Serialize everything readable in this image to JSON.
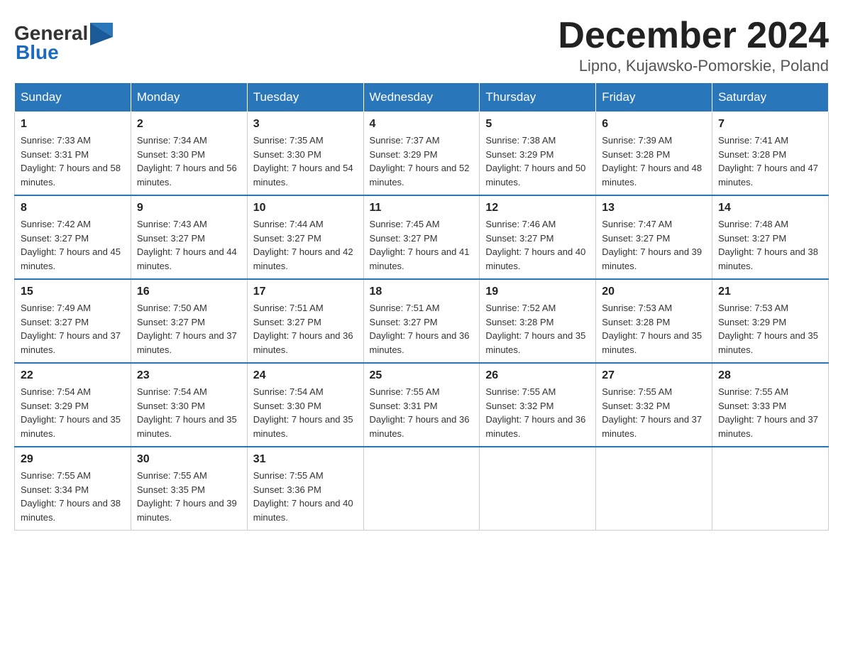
{
  "header": {
    "logo_general": "General",
    "logo_blue": "Blue",
    "month_title": "December 2024",
    "subtitle": "Lipno, Kujawsko-Pomorskie, Poland"
  },
  "days_of_week": [
    "Sunday",
    "Monday",
    "Tuesday",
    "Wednesday",
    "Thursday",
    "Friday",
    "Saturday"
  ],
  "weeks": [
    [
      {
        "day": "1",
        "sunrise": "7:33 AM",
        "sunset": "3:31 PM",
        "daylight": "7 hours and 58 minutes."
      },
      {
        "day": "2",
        "sunrise": "7:34 AM",
        "sunset": "3:30 PM",
        "daylight": "7 hours and 56 minutes."
      },
      {
        "day": "3",
        "sunrise": "7:35 AM",
        "sunset": "3:30 PM",
        "daylight": "7 hours and 54 minutes."
      },
      {
        "day": "4",
        "sunrise": "7:37 AM",
        "sunset": "3:29 PM",
        "daylight": "7 hours and 52 minutes."
      },
      {
        "day": "5",
        "sunrise": "7:38 AM",
        "sunset": "3:29 PM",
        "daylight": "7 hours and 50 minutes."
      },
      {
        "day": "6",
        "sunrise": "7:39 AM",
        "sunset": "3:28 PM",
        "daylight": "7 hours and 48 minutes."
      },
      {
        "day": "7",
        "sunrise": "7:41 AM",
        "sunset": "3:28 PM",
        "daylight": "7 hours and 47 minutes."
      }
    ],
    [
      {
        "day": "8",
        "sunrise": "7:42 AM",
        "sunset": "3:27 PM",
        "daylight": "7 hours and 45 minutes."
      },
      {
        "day": "9",
        "sunrise": "7:43 AM",
        "sunset": "3:27 PM",
        "daylight": "7 hours and 44 minutes."
      },
      {
        "day": "10",
        "sunrise": "7:44 AM",
        "sunset": "3:27 PM",
        "daylight": "7 hours and 42 minutes."
      },
      {
        "day": "11",
        "sunrise": "7:45 AM",
        "sunset": "3:27 PM",
        "daylight": "7 hours and 41 minutes."
      },
      {
        "day": "12",
        "sunrise": "7:46 AM",
        "sunset": "3:27 PM",
        "daylight": "7 hours and 40 minutes."
      },
      {
        "day": "13",
        "sunrise": "7:47 AM",
        "sunset": "3:27 PM",
        "daylight": "7 hours and 39 minutes."
      },
      {
        "day": "14",
        "sunrise": "7:48 AM",
        "sunset": "3:27 PM",
        "daylight": "7 hours and 38 minutes."
      }
    ],
    [
      {
        "day": "15",
        "sunrise": "7:49 AM",
        "sunset": "3:27 PM",
        "daylight": "7 hours and 37 minutes."
      },
      {
        "day": "16",
        "sunrise": "7:50 AM",
        "sunset": "3:27 PM",
        "daylight": "7 hours and 37 minutes."
      },
      {
        "day": "17",
        "sunrise": "7:51 AM",
        "sunset": "3:27 PM",
        "daylight": "7 hours and 36 minutes."
      },
      {
        "day": "18",
        "sunrise": "7:51 AM",
        "sunset": "3:27 PM",
        "daylight": "7 hours and 36 minutes."
      },
      {
        "day": "19",
        "sunrise": "7:52 AM",
        "sunset": "3:28 PM",
        "daylight": "7 hours and 35 minutes."
      },
      {
        "day": "20",
        "sunrise": "7:53 AM",
        "sunset": "3:28 PM",
        "daylight": "7 hours and 35 minutes."
      },
      {
        "day": "21",
        "sunrise": "7:53 AM",
        "sunset": "3:29 PM",
        "daylight": "7 hours and 35 minutes."
      }
    ],
    [
      {
        "day": "22",
        "sunrise": "7:54 AM",
        "sunset": "3:29 PM",
        "daylight": "7 hours and 35 minutes."
      },
      {
        "day": "23",
        "sunrise": "7:54 AM",
        "sunset": "3:30 PM",
        "daylight": "7 hours and 35 minutes."
      },
      {
        "day": "24",
        "sunrise": "7:54 AM",
        "sunset": "3:30 PM",
        "daylight": "7 hours and 35 minutes."
      },
      {
        "day": "25",
        "sunrise": "7:55 AM",
        "sunset": "3:31 PM",
        "daylight": "7 hours and 36 minutes."
      },
      {
        "day": "26",
        "sunrise": "7:55 AM",
        "sunset": "3:32 PM",
        "daylight": "7 hours and 36 minutes."
      },
      {
        "day": "27",
        "sunrise": "7:55 AM",
        "sunset": "3:32 PM",
        "daylight": "7 hours and 37 minutes."
      },
      {
        "day": "28",
        "sunrise": "7:55 AM",
        "sunset": "3:33 PM",
        "daylight": "7 hours and 37 minutes."
      }
    ],
    [
      {
        "day": "29",
        "sunrise": "7:55 AM",
        "sunset": "3:34 PM",
        "daylight": "7 hours and 38 minutes."
      },
      {
        "day": "30",
        "sunrise": "7:55 AM",
        "sunset": "3:35 PM",
        "daylight": "7 hours and 39 minutes."
      },
      {
        "day": "31",
        "sunrise": "7:55 AM",
        "sunset": "3:36 PM",
        "daylight": "7 hours and 40 minutes."
      },
      null,
      null,
      null,
      null
    ]
  ]
}
